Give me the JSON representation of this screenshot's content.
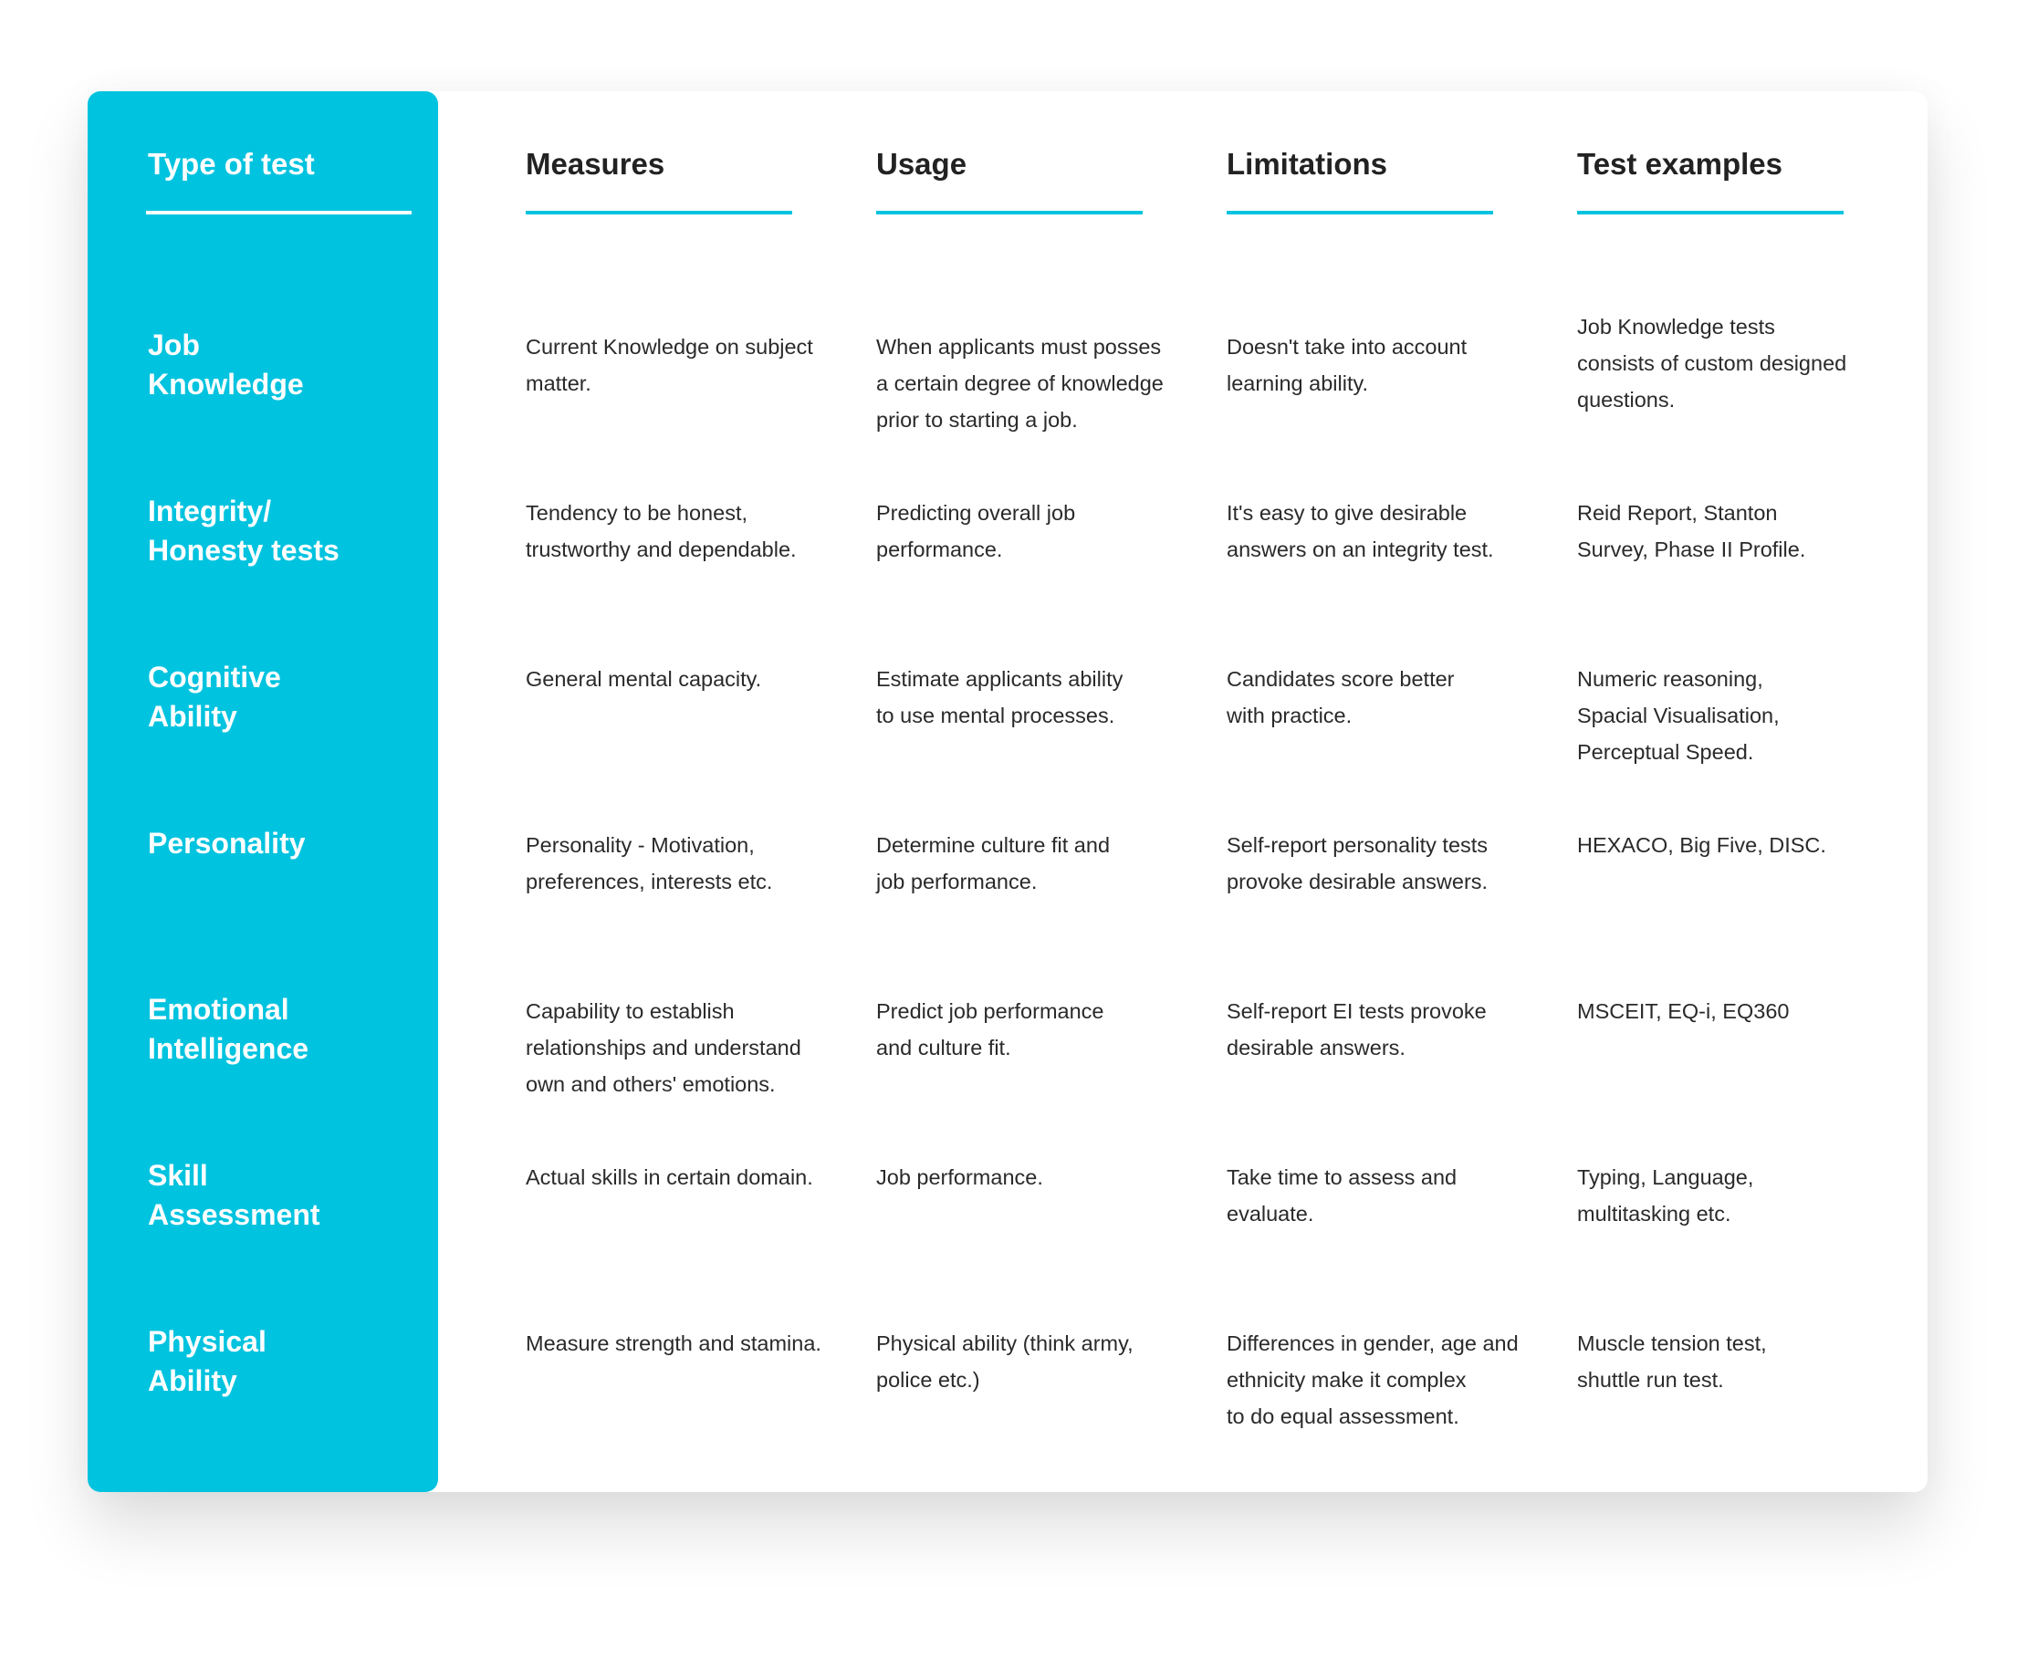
{
  "table": {
    "headers": [
      "Type of test",
      "Measures",
      "Usage",
      "Limitations",
      "Test examples"
    ],
    "rows": [
      {
        "type": "Job\nKnowledge",
        "type_lines": [
          "Job",
          "Knowledge"
        ],
        "measures": "Current Knowledge on subject matter.",
        "usage": "When applicants must posses a certain degree of knowledge prior to starting a job.",
        "limitations": "Doesn't take into account learning ability.",
        "examples": "Job Knowledge tests consists of custom designed questions."
      },
      {
        "type": "Integrity/ Honesty tests",
        "type_lines": [
          "Integrity/",
          "Honesty tests"
        ],
        "measures": "Tendency to be honest, trustworthy and dependable.",
        "usage": "Predicting overall job performance.",
        "limitations": "It's easy to give desirable answers on an integrity test.",
        "examples": "Reid Report, Stanton Survey, Phase II Profile."
      },
      {
        "type": "Cognitive Ability",
        "type_lines": [
          "Cognitive",
          "Ability"
        ],
        "measures": "General mental capacity.",
        "usage": "Estimate applicants ability to use mental processes.",
        "limitations": "Candidates score better with practice.",
        "examples": "Numeric reasoning, Spacial Visualisation, Perceptual Speed."
      },
      {
        "type": "Personality",
        "type_lines": [
          "Personality"
        ],
        "measures": "Personality - Motivation, preferences, interests etc.",
        "usage": "Determine culture fit and job performance.",
        "limitations": "Self-report personality tests provoke desirable answers.",
        "examples": "HEXACO, Big Five, DISC."
      },
      {
        "type": "Emotional Intelligence",
        "type_lines": [
          "Emotional",
          "Intelligence"
        ],
        "measures": "Capability to establish relationships and understand own and others' emotions.",
        "usage": "Predict job performance and culture fit.",
        "limitations": "Self-report EI tests provoke desirable answers.",
        "examples": "MSCEIT, EQ-i, EQ360"
      },
      {
        "type": "Skill Assessment",
        "type_lines": [
          "Skill",
          "Assessment"
        ],
        "measures": "Actual skills in certain domain.",
        "usage": "Job performance.",
        "limitations": "Take time to assess and evaluate.",
        "examples": "Typing, Language, multitasking etc."
      },
      {
        "type": "Physical Ability",
        "type_lines": [
          "Physical",
          "Ability"
        ],
        "measures": "Measure strength and stamina.",
        "usage": "Physical ability (think army, police etc.)",
        "limitations": "Differences in gender, age and ethnicity make it complex to do equal assessment.",
        "examples": "Muscle tension test, shuttle run test."
      }
    ],
    "cell_lines": [
      [
        [
          "Current Knowledge on subject",
          "matter."
        ],
        [
          "When applicants must posses",
          "a certain degree of knowledge",
          "prior to starting a job."
        ],
        [
          "Doesn't take into account",
          "learning ability."
        ],
        [
          "Job Knowledge tests",
          "consists of custom designed",
          "questions."
        ]
      ],
      [
        [
          "Tendency to be honest,",
          "trustworthy and dependable."
        ],
        [
          "Predicting overall job",
          "performance."
        ],
        [
          "It's easy to give desirable",
          "answers on an integrity test."
        ],
        [
          "Reid Report, Stanton",
          "Survey, Phase II Profile."
        ]
      ],
      [
        [
          "General mental capacity."
        ],
        [
          "Estimate applicants ability",
          "to use mental processes."
        ],
        [
          "Candidates score better",
          "with practice."
        ],
        [
          "Numeric reasoning,",
          "Spacial Visualisation,",
          "Perceptual Speed."
        ]
      ],
      [
        [
          "Personality - Motivation,",
          "preferences, interests etc."
        ],
        [
          "Determine culture fit and",
          "job performance."
        ],
        [
          "Self-report personality tests",
          "provoke desirable answers."
        ],
        [
          "HEXACO, Big Five, DISC."
        ]
      ],
      [
        [
          "Capability to establish",
          "relationships and understand",
          "own and others' emotions."
        ],
        [
          "Predict job performance",
          "and culture fit."
        ],
        [
          "Self-report EI tests provoke",
          "desirable answers."
        ],
        [
          "MSCEIT, EQ-i, EQ360"
        ]
      ],
      [
        [
          "Actual skills in certain domain."
        ],
        [
          "Job performance."
        ],
        [
          "Take time to assess and",
          "evaluate."
        ],
        [
          "Typing, Language,",
          "multitasking etc."
        ]
      ],
      [
        [
          "Measure strength and stamina."
        ],
        [
          "Physical ability (think army,",
          "police etc.)"
        ],
        [
          "Differences in gender, age and",
          "ethnicity make it complex",
          "to do equal assessment."
        ],
        [
          "Muscle tension test,",
          "shuttle run test."
        ]
      ]
    ]
  },
  "colors": {
    "accent": "#00C3DF",
    "heading_text": "#222222",
    "body_text": "#2a2a2a",
    "panel_text": "#ffffff"
  }
}
